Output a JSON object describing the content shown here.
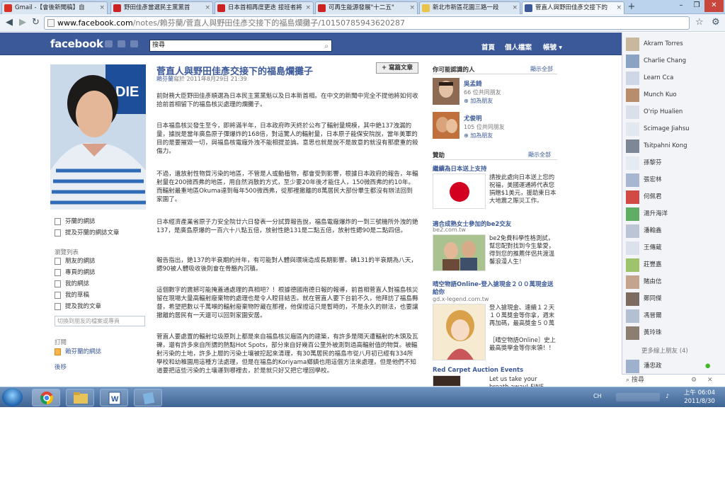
{
  "browser": {
    "tabs": [
      {
        "label": "Gmail -【會後新聞稿】自"
      },
      {
        "label": "野田佳彥當選民主黨黨首"
      },
      {
        "label": "日本首相再度更迭 接班者將"
      },
      {
        "label": "可再生能源發展\"十二五\""
      },
      {
        "label": "新北市新區花園三路一段"
      },
      {
        "label": "菅直人與野田佳彥交接下的"
      }
    ],
    "new_tab": "+",
    "url_domain": "www.facebook.com",
    "url_path": "/notes/賴芬蘭/菅直人與野田佳彥交接下的福島爛攤子/10150785943620287"
  },
  "fb": {
    "logo": "facebook",
    "search_value": "搜尋",
    "nav": [
      "首頁",
      "個人檔案",
      "帳號 ▾"
    ]
  },
  "left": {
    "links1": [
      "芬蘭的網誌",
      "提及芬蘭的網誌文章"
    ],
    "browse_head": "瀏覽列表",
    "links2": [
      "朋友的網誌",
      "專頁的網誌",
      "我的網誌",
      "我的草稿",
      "提及我的文章"
    ],
    "search_placeholder": "切換到朋友的檔案或專頁",
    "subscribe_head": "訂閱",
    "subscribe_link": "賴芬蘭的網誌",
    "back": "後移"
  },
  "note": {
    "title": "菅直人與野田佳彥交接下的福島爛攤子",
    "author": "賴芬蘭",
    "meta": "寫於 2011年8月29日 21:39",
    "write_button": "+ 寫篇文章",
    "paragraphs": [
      "前財務大臣野田佳彥順選為日本民主黨黨魁以及日本新首相。在中文的新聞中完全不提他將如何收拾前首相留下的福島核災處理的爛攤子。",
      "日本福島核災發生至今，即將滿半年，日本政府昨天終於公布了輻射量規模，其中銫137洩漏的量，據說是當年廣島原子彈爆炸的168倍，對這驚人的輻射量，日本原子能保安院說，當年美軍的目的是要摧毀一切，與福島核電廠外洩不能相提並論。意思也就是說不是故意的就沒有那麼重的殺傷力。",
      "不過，遺放射性物質污染的地區，不管是人或動植物，都會受到影響，根據日本政府的報告，年輻射量在200微西弗的地區，用自然消散的方式，至少要20年後才能住人，150微西弗的約10年。而輻射最重地區Okuma達到每年500微西弗，從那裡撤離的8萬居民大部份畢生都沒有辦法回到家園了。",
      "日本經濟產業省原子力安全院廿六日發表一分試算報告說，福島電廠爆炸的一到三號機所外洩的銫137，是廣島原爆的一百六十八點五倍，放射性銫131是二點五倍，放射性鍶90是二點四倍。",
      "報告指出，銫137的半衰期約卅年，有可能對人體與環境造成長期影響。碘131的半衰期為八天，鍶90被人體吸收後則會在骨骼內沉積。",
      "這個數字的震撼可能掩蓋通處理的真相吧？！根據德國南德日報的報導，前首相菅直人對福島核災留在現場大量高輻射廢棄物的處理也是令人瞠目結舌。就在菅直人要下台前不久，他拜訪了福島縣督，希望把數以千萬噸的輻射廢棄物貯藏在那裡，他保證這只是暫時的，不是永久的辦法，也要讓撤離的居民有一天還可以回到家園安居。",
      "菅直人要處置的輻射垃圾原則上都是來自福島核災廠區內的建築，有許多是隔天遭輻射的木頭及瓦礫，還有許多來自所謂的熱點Hot Spots，部分來自好幾百公里外被測到過高輻射值的物質。被輻射污染的土地，許多上層的污染土壤被挖起來清理，有30萬居民的福島市從八月初已經有334所學校和幼稚園用這種方法處理，但是在福島的Koriyama鄉鎮也用這個方法來處理，但是他們不知道要把這些污染的土壤運到哪裡去，於是就只好又把它埋回學校。"
    ]
  },
  "right": {
    "pymk_head": "你可能認識的人",
    "see_all": "顯示全部",
    "people": [
      {
        "name": "吳孟錡",
        "mutual": "66 位共同朋友",
        "add": "加為朋友"
      },
      {
        "name": "尤俊明",
        "mutual": "105 位共同朋友",
        "add": "加為朋友"
      }
    ],
    "sponsored_head": "贊助",
    "ads": [
      {
        "title": "繼續為日本送上支持",
        "url": "",
        "text": "請按此處向日本送上您的祝福，美國運通將代表您捐贈$1美元，援助東日本大地震之賑災工作。"
      },
      {
        "title": "適合成熟女士參加的be2交友",
        "url": "be2.com.tw",
        "text": "be2免費科學性格測試，幫您配對找到今生摯愛，得到您的推薦伴侶共渡溫馨浪漫人生！"
      },
      {
        "title": "晴空物語Online-登入搶現金２００萬現金送給你",
        "url": "gd.x-legend.com.tw",
        "text": "登入搶現金、連續１２天１０萬獎金等你拿，週末再加碼，最高獎金５０萬",
        "text2": "［晴空物語Online］史上最高獎學金等你來領！！"
      },
      {
        "title": "Red Carpet Auction Events",
        "url": "",
        "text": "Let us take your breath away! FINE"
      }
    ]
  },
  "chat": {
    "friends": [
      "Akram Torres",
      "Charlie Chang",
      "Learn Cca",
      "Munch Kuo",
      "O'rip Hualien",
      "Scimage Jiahsu",
      "Tsitpahni Kong",
      "孫黎芬",
      "張宏林",
      "何佩君",
      "湯升海洋",
      "潘翰鑫",
      "王傳蔵",
      "莊豐嘉",
      "賭由信",
      "鄭同傑",
      "馮晉爾",
      "黃玲珠"
    ],
    "more_online": "更多線上朋友 (4)",
    "online_friend": "潘忠政",
    "search": "搜尋"
  },
  "taskbar": {
    "lang": "CH",
    "time": "上午 06:04",
    "date": "2011/8/30"
  }
}
